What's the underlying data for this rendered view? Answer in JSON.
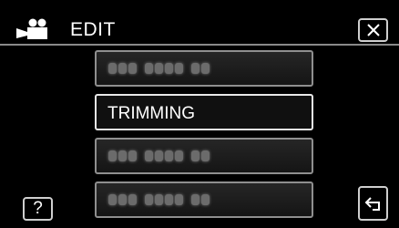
{
  "header": {
    "title": "EDIT",
    "icon": "video-camera-icon"
  },
  "buttons": {
    "close_icon": "close-icon",
    "help_label": "?",
    "back_icon": "return-arrow-icon"
  },
  "menu": {
    "items": [
      {
        "label": "",
        "blurred": true
      },
      {
        "label": "TRIMMING",
        "selected": true
      },
      {
        "label": "",
        "blurred": true
      },
      {
        "label": "",
        "blurred": true
      }
    ]
  },
  "colors": {
    "background": "#000000",
    "border": "#cfcfcf",
    "selected_border": "#e8e8e8"
  }
}
